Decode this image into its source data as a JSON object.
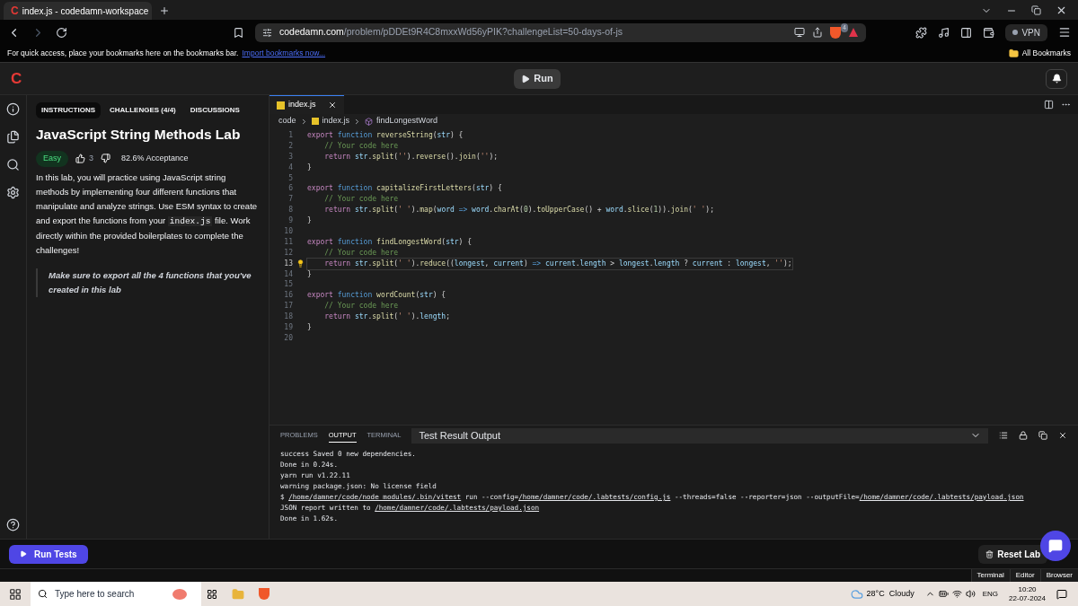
{
  "browser": {
    "tab": {
      "title": "index.js - codedamn-workspace",
      "logo": "C"
    },
    "url": {
      "host": "codedamn.com",
      "path": "/problem/pDDEt9R4C8mxxWd56yPIK?challengeList=50-days-of-js"
    },
    "shields_count": "4",
    "vpn": "VPN",
    "bookmarks_hint": "For quick access, place your bookmarks here on the bookmarks bar.",
    "bookmarks_link": "Import bookmarks now...",
    "all_bookmarks": "All Bookmarks"
  },
  "app": {
    "logo": "C",
    "run": "Run"
  },
  "tabs": [
    {
      "label": "INSTRUCTIONS",
      "selected": true
    },
    {
      "label": "CHALLENGES (4/4)",
      "selected": false
    },
    {
      "label": "DISCUSSIONS",
      "selected": false
    }
  ],
  "lab": {
    "title": "JavaScript String Methods Lab",
    "difficulty": "Easy",
    "likes": "3",
    "acceptance": "82.6% Acceptance",
    "description": [
      "In this lab, you will practice using JavaScript string methods by implementing four different functions that manipulate and analyze strings. Use ESM syntax to create and export the functions from your ",
      "index.js",
      " file. Work directly within the provided boilerplates to complete the challenges!"
    ],
    "note": "Make sure to export all the 4 functions that you've created in this lab"
  },
  "editor": {
    "tab": "index.js",
    "breadcrumb": [
      "code",
      "index.js",
      "findLongestWord"
    ],
    "lines": [
      {
        "number": "1",
        "current": false,
        "tokens": [
          {
            "kind": "kw",
            "t": "export "
          },
          {
            "kind": "decl",
            "t": "function "
          },
          {
            "kind": "fn",
            "t": "reverseString"
          },
          {
            "kind": "plain",
            "t": "("
          },
          {
            "kind": "var",
            "t": "str"
          },
          {
            "kind": "plain",
            "t": ") {"
          }
        ]
      },
      {
        "number": "2",
        "current": false,
        "tokens": [
          {
            "kind": "com",
            "t": "    // Your code here"
          }
        ]
      },
      {
        "number": "3",
        "current": false,
        "tokens": [
          {
            "kind": "kw",
            "t": "    return "
          },
          {
            "kind": "var",
            "t": "str"
          },
          {
            "kind": "plain",
            "t": "."
          },
          {
            "kind": "fn",
            "t": "split"
          },
          {
            "kind": "plain",
            "t": "("
          },
          {
            "kind": "str",
            "t": "''"
          },
          {
            "kind": "plain",
            "t": ")."
          },
          {
            "kind": "fn",
            "t": "reverse"
          },
          {
            "kind": "plain",
            "t": "()."
          },
          {
            "kind": "fn",
            "t": "join"
          },
          {
            "kind": "plain",
            "t": "("
          },
          {
            "kind": "str",
            "t": "''"
          },
          {
            "kind": "plain",
            "t": ");"
          }
        ]
      },
      {
        "number": "4",
        "current": false,
        "tokens": [
          {
            "kind": "plain",
            "t": "}"
          }
        ]
      },
      {
        "number": "5",
        "current": false
      },
      {
        "number": "6",
        "current": false,
        "tokens": [
          {
            "kind": "kw",
            "t": "export "
          },
          {
            "kind": "decl",
            "t": "function "
          },
          {
            "kind": "fn",
            "t": "capitalizeFirstLetters"
          },
          {
            "kind": "plain",
            "t": "("
          },
          {
            "kind": "var",
            "t": "str"
          },
          {
            "kind": "plain",
            "t": ") {"
          }
        ]
      },
      {
        "number": "7",
        "current": false,
        "tokens": [
          {
            "kind": "com",
            "t": "    // Your code here"
          }
        ]
      },
      {
        "number": "8",
        "current": false,
        "tokens": [
          {
            "kind": "kw",
            "t": "    return "
          },
          {
            "kind": "var",
            "t": "str"
          },
          {
            "kind": "plain",
            "t": "."
          },
          {
            "kind": "fn",
            "t": "split"
          },
          {
            "kind": "plain",
            "t": "("
          },
          {
            "kind": "str",
            "t": "' '"
          },
          {
            "kind": "plain",
            "t": ")."
          },
          {
            "kind": "fn",
            "t": "map"
          },
          {
            "kind": "plain",
            "t": "("
          },
          {
            "kind": "var",
            "t": "word"
          },
          {
            "kind": "decl",
            "t": " => "
          },
          {
            "kind": "var",
            "t": "word"
          },
          {
            "kind": "plain",
            "t": "."
          },
          {
            "kind": "fn",
            "t": "charAt"
          },
          {
            "kind": "plain",
            "t": "("
          },
          {
            "kind": "num",
            "t": "0"
          },
          {
            "kind": "plain",
            "t": ")."
          },
          {
            "kind": "fn",
            "t": "toUpperCase"
          },
          {
            "kind": "plain",
            "t": "() + "
          },
          {
            "kind": "var",
            "t": "word"
          },
          {
            "kind": "plain",
            "t": "."
          },
          {
            "kind": "fn",
            "t": "slice"
          },
          {
            "kind": "plain",
            "t": "("
          },
          {
            "kind": "num",
            "t": "1"
          },
          {
            "kind": "plain",
            "t": "))."
          },
          {
            "kind": "fn",
            "t": "join"
          },
          {
            "kind": "plain",
            "t": "("
          },
          {
            "kind": "str",
            "t": "' '"
          },
          {
            "kind": "plain",
            "t": ");"
          }
        ]
      },
      {
        "number": "9",
        "current": false,
        "tokens": [
          {
            "kind": "plain",
            "t": "}"
          }
        ]
      },
      {
        "number": "10",
        "current": false
      },
      {
        "number": "11",
        "current": false,
        "tokens": [
          {
            "kind": "kw",
            "t": "export "
          },
          {
            "kind": "decl",
            "t": "function "
          },
          {
            "kind": "fn",
            "t": "findLongestWord"
          },
          {
            "kind": "plain",
            "t": "("
          },
          {
            "kind": "var",
            "t": "str"
          },
          {
            "kind": "plain",
            "t": ") {"
          }
        ]
      },
      {
        "number": "12",
        "current": false,
        "tokens": [
          {
            "kind": "com",
            "t": "    // Your code here"
          }
        ]
      },
      {
        "number": "13",
        "current": true,
        "tokens": [
          {
            "kind": "kw",
            "t": "    return "
          },
          {
            "kind": "var",
            "t": "str"
          },
          {
            "kind": "plain",
            "t": "."
          },
          {
            "kind": "fn",
            "t": "split"
          },
          {
            "kind": "plain",
            "t": "("
          },
          {
            "kind": "str",
            "t": "' '"
          },
          {
            "kind": "plain",
            "t": ")."
          },
          {
            "kind": "fn",
            "t": "reduce"
          },
          {
            "kind": "plain",
            "t": "(("
          },
          {
            "kind": "var",
            "t": "longest"
          },
          {
            "kind": "plain",
            "t": ", "
          },
          {
            "kind": "var",
            "t": "current"
          },
          {
            "kind": "plain",
            "t": ")"
          },
          {
            "kind": "decl",
            "t": " => "
          },
          {
            "kind": "var",
            "t": "current"
          },
          {
            "kind": "plain",
            "t": "."
          },
          {
            "kind": "var",
            "t": "length"
          },
          {
            "kind": "plain",
            "t": " > "
          },
          {
            "kind": "var",
            "t": "longest"
          },
          {
            "kind": "plain",
            "t": "."
          },
          {
            "kind": "var",
            "t": "length"
          },
          {
            "kind": "plain",
            "t": " ? "
          },
          {
            "kind": "var",
            "t": "current"
          },
          {
            "kind": "plain",
            "t": " : "
          },
          {
            "kind": "var",
            "t": "longest"
          },
          {
            "kind": "plain",
            "t": ", "
          },
          {
            "kind": "str",
            "t": "''"
          },
          {
            "kind": "plain",
            "t": ");"
          }
        ]
      },
      {
        "number": "14",
        "current": false,
        "tokens": [
          {
            "kind": "plain",
            "t": "}"
          }
        ]
      },
      {
        "number": "15",
        "current": false
      },
      {
        "number": "16",
        "current": false,
        "tokens": [
          {
            "kind": "kw",
            "t": "export "
          },
          {
            "kind": "decl",
            "t": "function "
          },
          {
            "kind": "fn",
            "t": "wordCount"
          },
          {
            "kind": "plain",
            "t": "("
          },
          {
            "kind": "var",
            "t": "str"
          },
          {
            "kind": "plain",
            "t": ") {"
          }
        ]
      },
      {
        "number": "17",
        "current": false,
        "tokens": [
          {
            "kind": "com",
            "t": "    // Your code here"
          }
        ]
      },
      {
        "number": "18",
        "current": false,
        "tokens": [
          {
            "kind": "kw",
            "t": "    return "
          },
          {
            "kind": "var",
            "t": "str"
          },
          {
            "kind": "plain",
            "t": "."
          },
          {
            "kind": "fn",
            "t": "split"
          },
          {
            "kind": "plain",
            "t": "("
          },
          {
            "kind": "str",
            "t": "' '"
          },
          {
            "kind": "plain",
            "t": ")."
          },
          {
            "kind": "var",
            "t": "length"
          },
          {
            "kind": "plain",
            "t": ";"
          }
        ]
      },
      {
        "number": "19",
        "current": false,
        "tokens": [
          {
            "kind": "plain",
            "t": "}"
          }
        ]
      },
      {
        "number": "20",
        "current": false
      }
    ]
  },
  "panel": {
    "tabs": [
      {
        "label": "PROBLEMS",
        "selected": false
      },
      {
        "label": "OUTPUT",
        "selected": true
      },
      {
        "label": "TERMINAL",
        "selected": false
      }
    ],
    "channel": "Test Result Output",
    "output": [
      [
        {
          "t": "success Saved 0 new dependencies.",
          "link": false
        }
      ],
      [
        {
          "t": "Done in 0.24s.",
          "link": false
        }
      ],
      [
        {
          "t": "yarn run v1.22.11",
          "link": false
        }
      ],
      [
        {
          "t": "warning package.json: No license field",
          "link": false
        }
      ],
      [
        {
          "t": "$ ",
          "link": false
        },
        {
          "t": "/home/damner/code/node_modules/.bin/vitest",
          "link": true
        },
        {
          "t": " run --config=",
          "link": false
        },
        {
          "t": "/home/damner/code/.labtests/config.js",
          "link": true
        },
        {
          "t": " --threads=false --reporter=json --outputFile=",
          "link": false
        },
        {
          "t": "/home/damner/code/.labtests/payload.json",
          "link": true
        }
      ],
      [
        {
          "t": "JSON report written to ",
          "link": false
        },
        {
          "t": "/home/damner/code/.labtests/payload.json",
          "link": true
        }
      ],
      [
        {
          "t": "Done in 1.62s.",
          "link": false
        }
      ]
    ]
  },
  "footer": {
    "run_tests": "Run Tests",
    "reset": "Reset Lab",
    "modes": [
      {
        "label": "Terminal",
        "selected": false
      },
      {
        "label": "Editor",
        "selected": false
      },
      {
        "label": "Browser",
        "selected": false
      }
    ]
  },
  "taskbar": {
    "search_placeholder": "Type here to search",
    "weather": "28°C  Cloudy",
    "lang": "ENG",
    "time": "10:20",
    "date": "22-07-2024"
  }
}
